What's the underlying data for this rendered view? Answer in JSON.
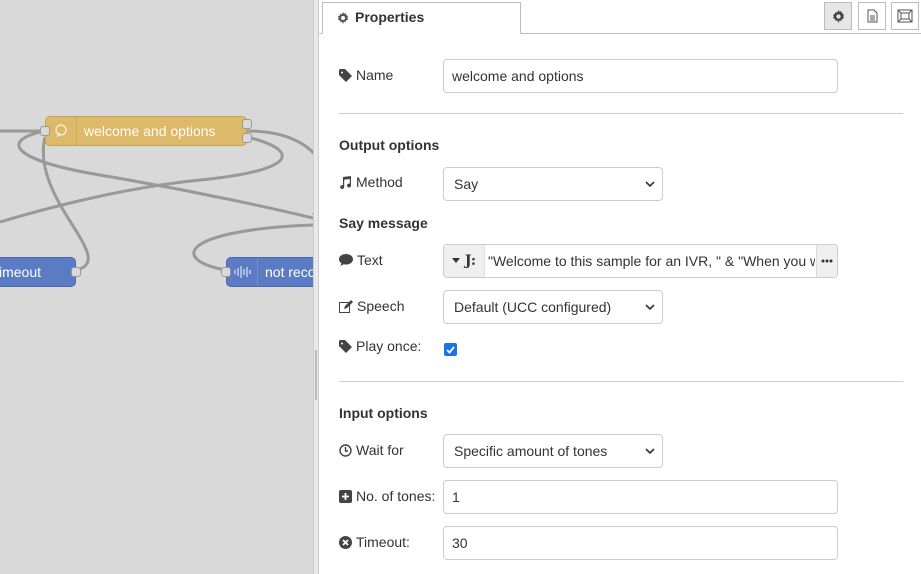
{
  "canvas": {
    "nodes": {
      "welcome": "welcome and options",
      "timeout": "imeout",
      "not_recognized": "not reco"
    }
  },
  "tray": {
    "tab_label": "Properties",
    "buttons": [
      "gear-icon",
      "document-icon",
      "frame-icon"
    ]
  },
  "form": {
    "name": {
      "label": "Name",
      "value": "welcome and options"
    },
    "output_section": "Output options",
    "method": {
      "label": "Method",
      "value": "Say"
    },
    "say_section": "Say message",
    "text": {
      "label": "Text",
      "value": "\"Welcome to this sample for an IVR, \" & \"When you want to...\""
    },
    "speech": {
      "label": "Speech",
      "value": "Default (UCC configured)"
    },
    "play_once": {
      "label": "Play once:",
      "checked": true
    },
    "input_section": "Input options",
    "wait_for": {
      "label": "Wait for",
      "value": "Specific amount of tones"
    },
    "tones": {
      "label": "No. of tones:",
      "value": "1"
    },
    "timeout": {
      "label": "Timeout:",
      "value": "30"
    }
  },
  "colors": {
    "function_node": "#ddb96a",
    "blue_node": "#5b7cc4",
    "checkbox": "#1a73e8"
  }
}
